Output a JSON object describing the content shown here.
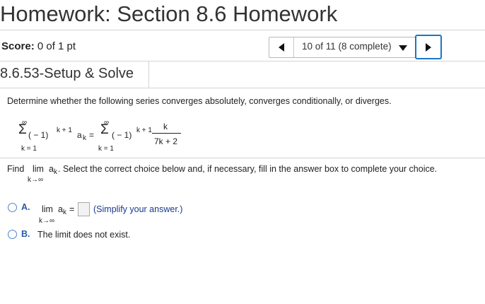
{
  "header": {
    "title": "Homework: Section 8.6 Homework"
  },
  "score": {
    "label": "Score:",
    "value": "0 of 1 pt"
  },
  "nav": {
    "progress": "10 of 11 (8 complete)"
  },
  "problem": {
    "title": "8.6.53-Setup & Solve",
    "prompt": "Determine whether the following series converges absolutely, converges conditionally, or diverges.",
    "series": {
      "sigma": "Σ",
      "upper": "∞",
      "lower": "k = 1",
      "term_a": "( − 1)",
      "exp": "k + 1",
      "a_base": "a",
      "a_sub": "k",
      "equals": "=",
      "frac_num": "k",
      "frac_den": "7k + 2"
    },
    "find": {
      "lead": "Find",
      "lim": "lim",
      "a_base": "a",
      "a_sub": "k",
      "limit_sub": "k→∞",
      "rest": ". Select the correct choice below and, if necessary, fill in the answer box to complete your choice."
    },
    "choices": [
      {
        "label": "A.",
        "lim": "lim",
        "a_base": "a",
        "a_sub": "k",
        "equals": "=",
        "limit_sub": "k→∞",
        "hint": "(Simplify your answer.)"
      },
      {
        "label": "B.",
        "text": "The limit does not exist."
      }
    ]
  },
  "colors": {
    "accent": "#1a76c8",
    "text": "#222222",
    "divider": "#d4d4d4"
  }
}
